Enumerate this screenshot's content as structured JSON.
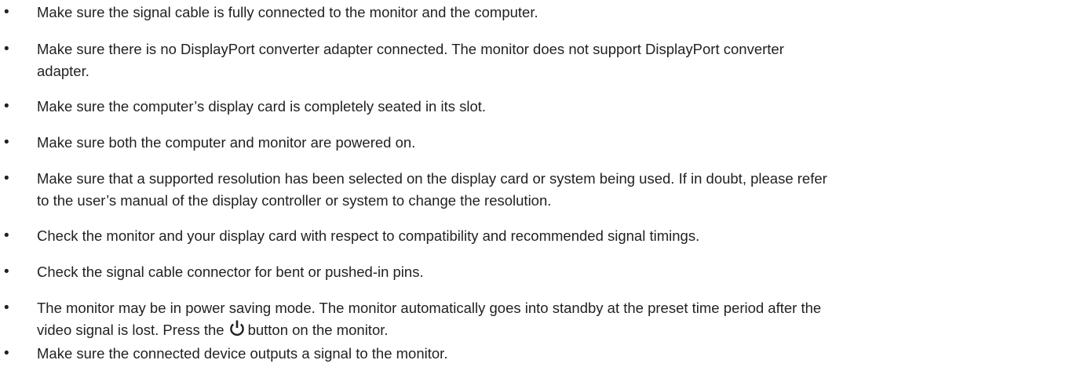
{
  "bullet_symbol": "•",
  "items": [
    {
      "lines": [
        "Make sure the signal cable is fully connected to the monitor and the computer."
      ]
    },
    {
      "lines": [
        "Make sure there is no DisplayPort converter adapter connected. The monitor does not support DisplayPort converter",
        "adapter."
      ]
    },
    {
      "lines": [
        "Make sure the computer’s display card is completely seated in its slot."
      ]
    },
    {
      "lines": [
        "Make sure both the computer and monitor are powered on."
      ]
    },
    {
      "lines": [
        "Make sure that a supported resolution has been selected on the display card or system being used. If in doubt, please refer",
        "to the user’s manual of the display controller or system to change the resolution."
      ]
    },
    {
      "lines": [
        "Check the monitor and your display card with respect to compatibility and recommended signal timings."
      ]
    },
    {
      "lines": [
        "Check the signal cable connector for bent or pushed-in pins."
      ]
    },
    {
      "lines": [
        "The monitor may be in power saving mode. The monitor automatically goes into standby at the preset time period after the"
      ],
      "line2_before_icon": "video signal is lost. Press the",
      "line2_after_icon": "button on the monitor.",
      "icon": "power-icon"
    },
    {
      "lines": [
        "Make sure the connected device outputs a signal to the monitor."
      ]
    }
  ]
}
